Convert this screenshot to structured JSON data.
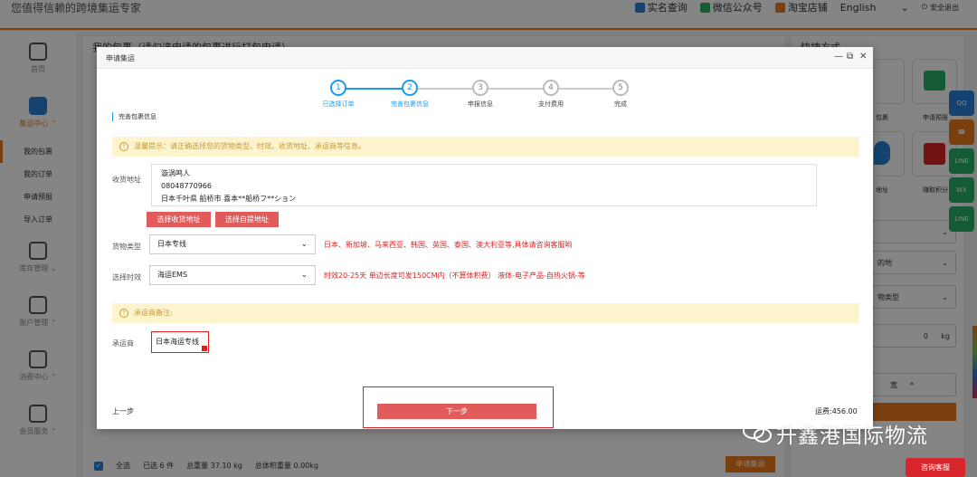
{
  "topbar": {
    "slogan": "您值得信赖的跨境集运专家",
    "links": [
      {
        "label": "实名查询",
        "icon": "id-card-icon",
        "color": "#2a7fd4"
      },
      {
        "label": "微信公众号",
        "icon": "wechat-icon",
        "color": "#2aae67"
      },
      {
        "label": "淘宝店铺",
        "icon": "taobao-icon",
        "color": "#e8791c"
      }
    ],
    "language": "English",
    "logout": "安全退出"
  },
  "leftnav": {
    "groups": [
      {
        "label": "首页",
        "icon": "home-icon"
      },
      {
        "label": "集运中心",
        "icon": "box-icon"
      },
      {
        "label": "库存管理",
        "icon": "inventory-icon"
      },
      {
        "label": "账户管理",
        "icon": "account-icon"
      },
      {
        "label": "消费中心",
        "icon": "wallet-icon"
      },
      {
        "label": "会员服务",
        "icon": "vip-icon"
      }
    ],
    "sub_items": [
      "我的包裹",
      "我的订单",
      "申请预报",
      "导入订单"
    ]
  },
  "main": {
    "heading": "我的包裹（请勾选申请的包裹进行打包申请）",
    "bottom": {
      "select_all": "全选",
      "selected": "已选 6 件",
      "total_weight": "总重量 37.10 kg",
      "total_volume_weight": "总体积重量 0.00kg",
      "apply_button": "申请集运"
    }
  },
  "right_panel": {
    "title": "快捷方式",
    "tiles": [
      "包裹",
      "申请预报",
      "地址",
      "赚取积分"
    ],
    "selects": [
      "",
      "的地",
      "物类型"
    ],
    "kg_value": "0",
    "kg_unit": "kg",
    "width_label": "宽",
    "star": "*"
  },
  "modal": {
    "title": "申请集运",
    "steps": [
      {
        "num": "1",
        "label": "已选择订单",
        "state": "done"
      },
      {
        "num": "2",
        "label": "完善包裹信息",
        "state": "done"
      },
      {
        "num": "3",
        "label": "申报信息",
        "state": "todo"
      },
      {
        "num": "4",
        "label": "支付费用",
        "state": "todo"
      },
      {
        "num": "5",
        "label": "完成",
        "state": "todo"
      }
    ],
    "section_label": "完善包裹信息",
    "notice": "温馨提示：请正确选择您的货物类型、时效、收货地址、承运商等信息。",
    "address": {
      "label": "收货地址",
      "name": "漩涡鸣人",
      "phone": "08048770966",
      "detail": "日本千叶県 船桥市 喜本**船桥フ**ション",
      "select_button": "选择收货地址",
      "pickup_button": "选择自提地址"
    },
    "cargo_type": {
      "label": "货物类型",
      "value": "日本专线",
      "note": "日本、新加坡、马来西亚、韩国、英国、泰国、澳大利亚等,具体请咨询客服哟"
    },
    "timeliness": {
      "label": "选择时效",
      "value": "海运EMS",
      "note": "时效20-25天 单边长度可发150CM内（不算体积费） 液体-电子产品-自热火锅-等"
    },
    "carrier_notice": "承运商备注:",
    "carrier": {
      "label": "承运商",
      "value": "日本海运专线"
    },
    "prev": "上一步",
    "next": "下一步",
    "fee": "运费:456.00"
  },
  "watermark": "升鑫港国际物流",
  "consult_button": "咨询客服",
  "side_icons": [
    "qq-icon",
    "phone-icon",
    "line-icon",
    "wechat-icon",
    "line-icon"
  ]
}
